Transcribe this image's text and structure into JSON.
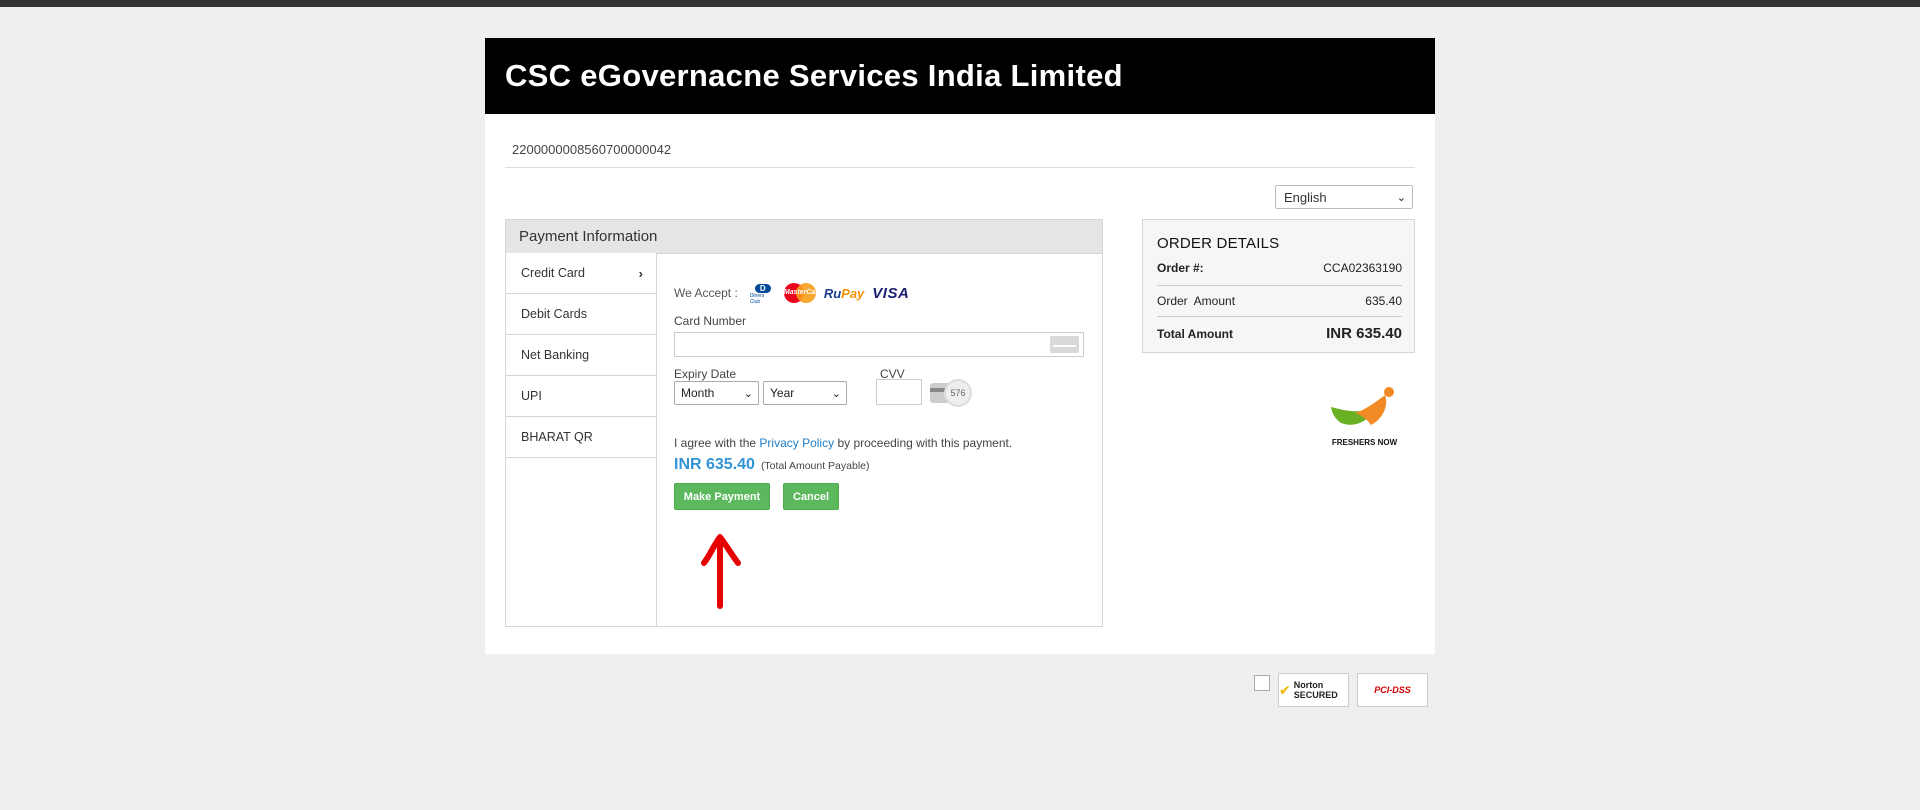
{
  "header": {
    "title": "CSC eGovernacne Services India Limited"
  },
  "transaction_id": "2200000008560700000042",
  "language": {
    "selected": "English"
  },
  "payment": {
    "panel_title": "Payment Information",
    "tabs": [
      {
        "label": "Credit Card",
        "active": true
      },
      {
        "label": "Debit Cards"
      },
      {
        "label": "Net Banking"
      },
      {
        "label": "UPI"
      },
      {
        "label": "BHARAT QR"
      }
    ],
    "we_accept_label": "We Accept :",
    "card_logos": {
      "diners": "Diners Club",
      "mastercard": "MasterCard",
      "rupay_ru": "Ru",
      "rupay_pay": "Pay",
      "visa": "VISA"
    },
    "card_number_label": "Card Number",
    "expiry_label": "Expiry Date",
    "month_placeholder": "Month",
    "year_placeholder": "Year",
    "cvv_label": "CVV",
    "cvv_hint": "576",
    "agree_prefix": "I agree with the",
    "privacy_link": "Privacy Policy",
    "agree_suffix": "by proceeding with this payment.",
    "amount": "INR 635.40",
    "amount_note": "(Total Amount Payable)",
    "make_payment_label": "Make Payment",
    "cancel_label": "Cancel"
  },
  "order_details": {
    "title": "ORDER DETAILS",
    "order_label": "Order #:",
    "order_value": "CCA02363190",
    "amount_label": "Order  Amount",
    "amount_value": "635.40",
    "total_label": "Total Amount",
    "total_value": "INR 635.40"
  },
  "watermark_logo": {
    "text": "FRESHERS NOW"
  },
  "seals": {
    "norton": "Norton SECURED",
    "pci": "PCI-DSS"
  },
  "colors": {
    "accent_blue": "#3194d6",
    "button_green": "#5cb85c",
    "annotation_red": "#e60000"
  }
}
